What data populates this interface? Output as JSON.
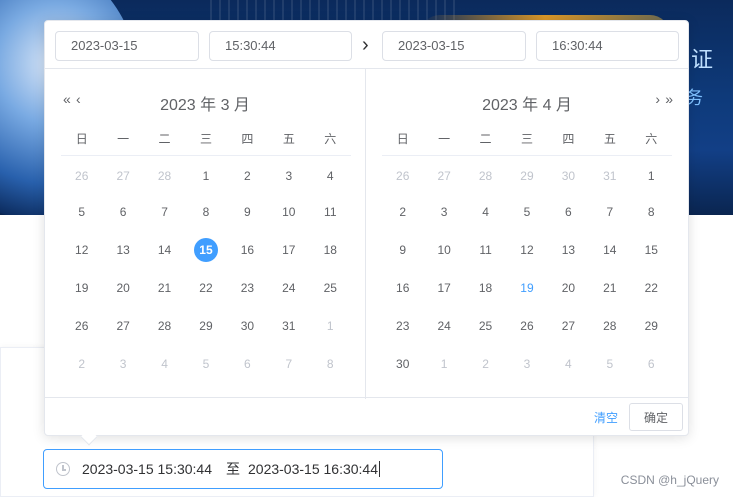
{
  "time_header": {
    "start_date": "2023-03-15",
    "start_time": "15:30:44",
    "end_date": "2023-03-15",
    "end_time": "16:30:44",
    "separator": "›"
  },
  "weekdays": [
    "日",
    "一",
    "二",
    "三",
    "四",
    "五",
    "六"
  ],
  "left_calendar": {
    "title": "2023 年 3 月",
    "prev_year": "«",
    "prev_month": "‹",
    "weeks": [
      [
        {
          "d": "26",
          "t": "other"
        },
        {
          "d": "27",
          "t": "other"
        },
        {
          "d": "28",
          "t": "other"
        },
        {
          "d": "1",
          "t": ""
        },
        {
          "d": "2",
          "t": ""
        },
        {
          "d": "3",
          "t": ""
        },
        {
          "d": "4",
          "t": ""
        }
      ],
      [
        {
          "d": "5",
          "t": ""
        },
        {
          "d": "6",
          "t": ""
        },
        {
          "d": "7",
          "t": ""
        },
        {
          "d": "8",
          "t": ""
        },
        {
          "d": "9",
          "t": ""
        },
        {
          "d": "10",
          "t": ""
        },
        {
          "d": "11",
          "t": ""
        }
      ],
      [
        {
          "d": "12",
          "t": ""
        },
        {
          "d": "13",
          "t": ""
        },
        {
          "d": "14",
          "t": ""
        },
        {
          "d": "15",
          "t": "selected"
        },
        {
          "d": "16",
          "t": ""
        },
        {
          "d": "17",
          "t": ""
        },
        {
          "d": "18",
          "t": ""
        }
      ],
      [
        {
          "d": "19",
          "t": ""
        },
        {
          "d": "20",
          "t": ""
        },
        {
          "d": "21",
          "t": ""
        },
        {
          "d": "22",
          "t": ""
        },
        {
          "d": "23",
          "t": ""
        },
        {
          "d": "24",
          "t": ""
        },
        {
          "d": "25",
          "t": ""
        }
      ],
      [
        {
          "d": "26",
          "t": ""
        },
        {
          "d": "27",
          "t": ""
        },
        {
          "d": "28",
          "t": ""
        },
        {
          "d": "29",
          "t": ""
        },
        {
          "d": "30",
          "t": ""
        },
        {
          "d": "31",
          "t": ""
        },
        {
          "d": "1",
          "t": "other"
        }
      ],
      [
        {
          "d": "2",
          "t": "other"
        },
        {
          "d": "3",
          "t": "other"
        },
        {
          "d": "4",
          "t": "other"
        },
        {
          "d": "5",
          "t": "other"
        },
        {
          "d": "6",
          "t": "other"
        },
        {
          "d": "7",
          "t": "other"
        },
        {
          "d": "8",
          "t": "other"
        }
      ]
    ]
  },
  "right_calendar": {
    "title": "2023 年 4 月",
    "next_month": "›",
    "next_year": "»",
    "weeks": [
      [
        {
          "d": "26",
          "t": "other"
        },
        {
          "d": "27",
          "t": "other"
        },
        {
          "d": "28",
          "t": "other"
        },
        {
          "d": "29",
          "t": "other"
        },
        {
          "d": "30",
          "t": "other"
        },
        {
          "d": "31",
          "t": "other"
        },
        {
          "d": "1",
          "t": ""
        }
      ],
      [
        {
          "d": "2",
          "t": ""
        },
        {
          "d": "3",
          "t": ""
        },
        {
          "d": "4",
          "t": ""
        },
        {
          "d": "5",
          "t": ""
        },
        {
          "d": "6",
          "t": ""
        },
        {
          "d": "7",
          "t": ""
        },
        {
          "d": "8",
          "t": ""
        }
      ],
      [
        {
          "d": "9",
          "t": ""
        },
        {
          "d": "10",
          "t": ""
        },
        {
          "d": "11",
          "t": ""
        },
        {
          "d": "12",
          "t": ""
        },
        {
          "d": "13",
          "t": ""
        },
        {
          "d": "14",
          "t": ""
        },
        {
          "d": "15",
          "t": ""
        }
      ],
      [
        {
          "d": "16",
          "t": ""
        },
        {
          "d": "17",
          "t": ""
        },
        {
          "d": "18",
          "t": ""
        },
        {
          "d": "19",
          "t": "today"
        },
        {
          "d": "20",
          "t": ""
        },
        {
          "d": "21",
          "t": ""
        },
        {
          "d": "22",
          "t": ""
        }
      ],
      [
        {
          "d": "23",
          "t": ""
        },
        {
          "d": "24",
          "t": ""
        },
        {
          "d": "25",
          "t": ""
        },
        {
          "d": "26",
          "t": ""
        },
        {
          "d": "27",
          "t": ""
        },
        {
          "d": "28",
          "t": ""
        },
        {
          "d": "29",
          "t": ""
        }
      ],
      [
        {
          "d": "30",
          "t": ""
        },
        {
          "d": "1",
          "t": "other"
        },
        {
          "d": "2",
          "t": "other"
        },
        {
          "d": "3",
          "t": "other"
        },
        {
          "d": "4",
          "t": "other"
        },
        {
          "d": "5",
          "t": "other"
        },
        {
          "d": "6",
          "t": "other"
        }
      ]
    ]
  },
  "footer": {
    "clear_label": "清空",
    "confirm_label": "确定"
  },
  "range_input": {
    "start": "2023-03-15 15:30:44",
    "separator": "至",
    "end": "2023-03-15 16:30:44"
  },
  "banner": {
    "side_text": "认证",
    "side_text2": "务"
  },
  "watermark": "CSDN @h_jQuery",
  "colors": {
    "accent": "#409eff",
    "muted": "#c0c4cc",
    "text": "#606266"
  },
  "icons": {
    "range_input": "clock-icon"
  }
}
